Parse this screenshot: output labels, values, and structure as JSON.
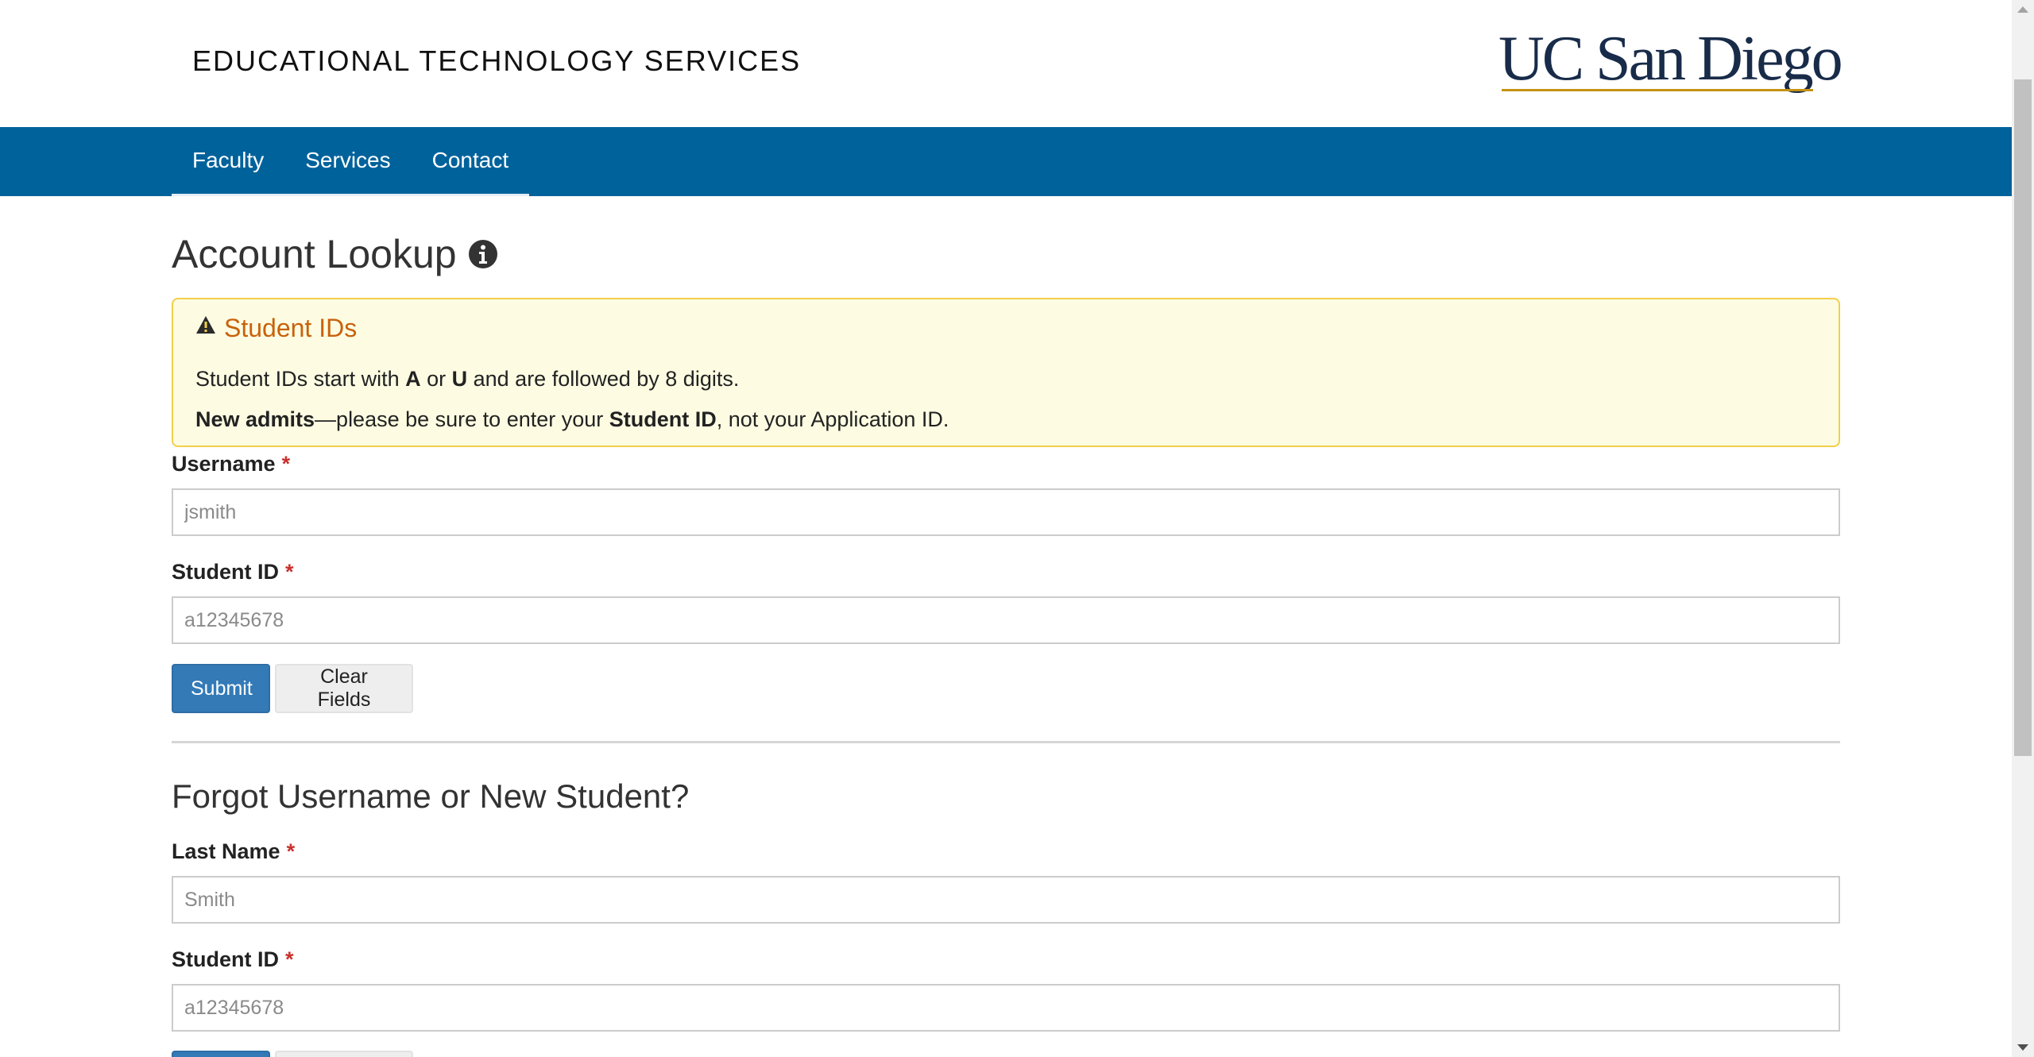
{
  "header": {
    "site_title": "EDUCATIONAL TECHNOLOGY SERVICES",
    "logo_text": "UC San Diego"
  },
  "nav": {
    "items": [
      {
        "label": "Faculty"
      },
      {
        "label": "Services"
      },
      {
        "label": "Contact"
      }
    ]
  },
  "lookup": {
    "heading": "Account Lookup",
    "alert": {
      "title": "Student IDs",
      "line1_pre": "Student IDs start with ",
      "line1_a": "A",
      "line1_or": " or ",
      "line1_u": "U",
      "line1_post": " and are followed by 8 digits.",
      "line2_bold1": "New admits",
      "line2_mid": "—please be sure to enter your ",
      "line2_bold2": "Student ID",
      "line2_post": ", not your Application ID."
    },
    "username_label": "Username",
    "username_placeholder": "jsmith",
    "student_id_label": "Student ID",
    "student_id_placeholder": "a12345678",
    "submit_label": "Submit",
    "clear_label": "Clear Fields"
  },
  "forgot": {
    "heading": "Forgot Username or New Student?",
    "last_name_label": "Last Name",
    "last_name_placeholder": "Smith",
    "student_id_label": "Student ID",
    "student_id_placeholder": "a12345678"
  },
  "required_marker": "*",
  "colors": {
    "nav_bg": "#00629b",
    "alert_bg": "#fdfce2",
    "alert_border": "#f2cf4a",
    "alert_title": "#c8620c",
    "primary_button": "#337ab7",
    "required": "#c9302c",
    "logo_navy": "#182b49",
    "logo_gold": "#c69214"
  }
}
